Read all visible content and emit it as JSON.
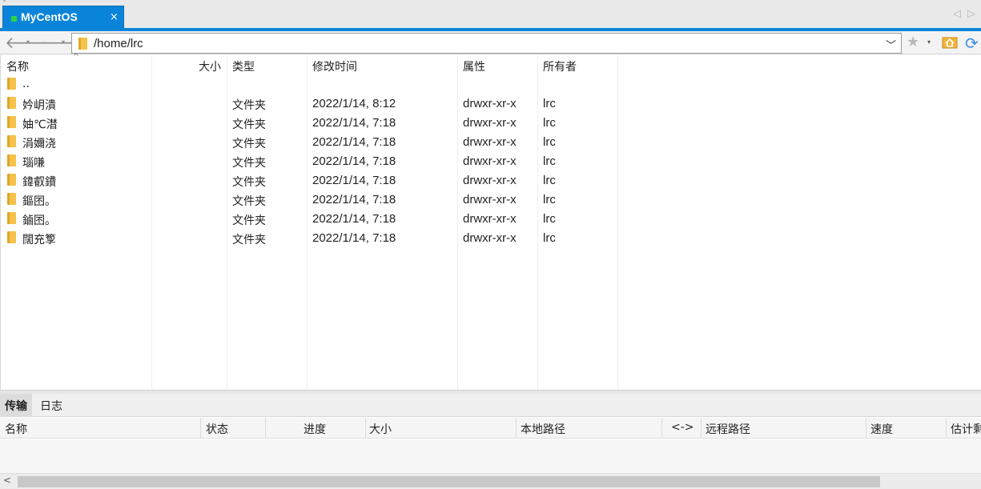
{
  "tab": {
    "title": "MyCentOS",
    "close": "×"
  },
  "nav": {
    "back": "🡐",
    "forward": "🡒",
    "drop": "▾"
  },
  "address": {
    "path": "/home/lrc",
    "dropdown": "﹀"
  },
  "icons": {
    "star": "★",
    "refresh": "⟳",
    "star_drop": "▾",
    "scroll_left": "◁",
    "scroll_right": "▷",
    "hscroll_left": "<"
  },
  "list": {
    "headers": {
      "name": "名称",
      "size": "大小",
      "type": "类型",
      "modified": "修改时间",
      "attributes": "属性",
      "owner": "所有者"
    },
    "rows": [
      {
        "name": "..",
        "type": "",
        "modified": "",
        "attributes": "",
        "owner": ""
      },
      {
        "name": "妗岄潰",
        "type": "文件夹",
        "modified": "2022/1/14, 8:12",
        "attributes": "drwxr-xr-x",
        "owner": "lrc"
      },
      {
        "name": "妯℃澘",
        "type": "文件夹",
        "modified": "2022/1/14, 7:18",
        "attributes": "drwxr-xr-x",
        "owner": "lrc"
      },
      {
        "name": "涓嬭浇",
        "type": "文件夹",
        "modified": "2022/1/14, 7:18",
        "attributes": "drwxr-xr-x",
        "owner": "lrc"
      },
      {
        "name": "瑙嗛",
        "type": "文件夹",
        "modified": "2022/1/14, 7:18",
        "attributes": "drwxr-xr-x",
        "owner": "lrc"
      },
      {
        "name": "鍏叡鐨",
        "type": "文件夹",
        "modified": "2022/1/14, 7:18",
        "attributes": "drwxr-xr-x",
        "owner": "lrc"
      },
      {
        "name": "鏂囨。",
        "type": "文件夹",
        "modified": "2022/1/14, 7:18",
        "attributes": "drwxr-xr-x",
        "owner": "lrc"
      },
      {
        "name": "鏀囨。",
        "type": "文件夹",
        "modified": "2022/1/14, 7:18",
        "attributes": "drwxr-xr-x",
        "owner": "lrc"
      },
      {
        "name": "闊充箰",
        "type": "文件夹",
        "modified": "2022/1/14, 7:18",
        "attributes": "drwxr-xr-x",
        "owner": "lrc"
      }
    ]
  },
  "panel": {
    "tabs": [
      "传输",
      "日志"
    ],
    "columns": [
      "名称",
      "状态",
      "进度",
      "大小",
      "本地路径",
      "<->",
      "远程路径",
      "速度",
      "估计剩"
    ]
  }
}
